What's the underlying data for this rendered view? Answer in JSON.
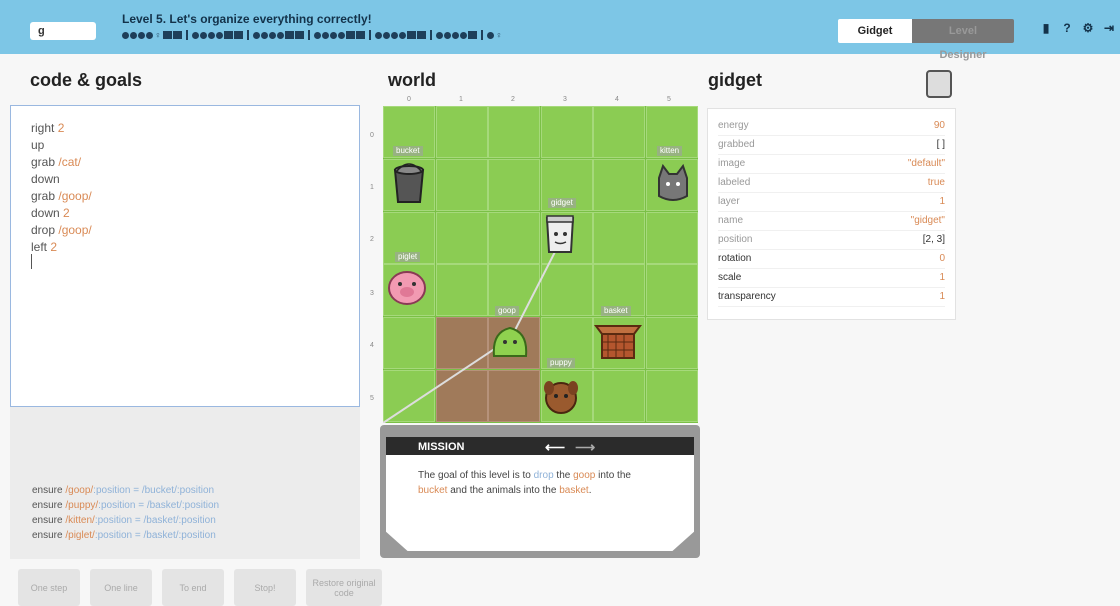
{
  "topbar": {
    "level_input": "g",
    "level_title": "Level 5. Let's organize everything correctly!",
    "tabs": [
      {
        "label": "Gidget",
        "active": true
      },
      {
        "label": "Level Designer",
        "active": false
      }
    ],
    "icons": [
      "book-icon",
      "help-icon",
      "settings-icon",
      "logout-icon"
    ],
    "accent_color": "#7dc6e6"
  },
  "code_panel": {
    "title": "code & goals",
    "code_lines": [
      {
        "cmd": "right",
        "arg": "2"
      },
      {
        "cmd": "up",
        "arg": ""
      },
      {
        "cmd": "grab",
        "arg": "/cat/"
      },
      {
        "cmd": "down",
        "arg": ""
      },
      {
        "cmd": "grab",
        "arg": "/goop/"
      },
      {
        "cmd": "down",
        "arg": "2"
      },
      {
        "cmd": "drop",
        "arg": "/goop/"
      },
      {
        "cmd": "left",
        "arg": "2"
      }
    ],
    "goals": [
      {
        "pre": "ensure ",
        "a": "/goop/",
        "mid": ":position = ",
        "b": "/bucket/",
        "post": ":position"
      },
      {
        "pre": "ensure ",
        "a": "/puppy/",
        "mid": ":position = ",
        "b": "/basket/",
        "post": ":position"
      },
      {
        "pre": "ensure ",
        "a": "/kitten/",
        "mid": ":position = ",
        "b": "/basket/",
        "post": ":position"
      },
      {
        "pre": "ensure ",
        "a": "/piglet/",
        "mid": ":position = ",
        "b": "/basket/",
        "post": ":position"
      }
    ],
    "buttons": [
      {
        "label": "One step"
      },
      {
        "label": "One line"
      },
      {
        "label": "To end"
      },
      {
        "label": "Stop!"
      },
      {
        "label": "Restore original code"
      }
    ]
  },
  "world": {
    "title": "world",
    "columns": [
      "0",
      "1",
      "2",
      "3",
      "4",
      "5"
    ],
    "rows": [
      "0",
      "1",
      "2",
      "3",
      "4",
      "5"
    ],
    "labels": [
      {
        "text": "bucket"
      },
      {
        "text": "kitten"
      },
      {
        "text": "gidget"
      },
      {
        "text": "piglet"
      },
      {
        "text": "goop"
      },
      {
        "text": "basket"
      },
      {
        "text": "puppy"
      }
    ]
  },
  "gidget_panel": {
    "title": "gidget",
    "properties": [
      {
        "key": "energy",
        "value": "90"
      },
      {
        "key": "grabbed",
        "value": "[ ]"
      },
      {
        "key": "image",
        "value": "\"default\""
      },
      {
        "key": "labeled",
        "value": "true"
      },
      {
        "key": "layer",
        "value": "1"
      },
      {
        "key": "name",
        "value": "\"gidget\""
      },
      {
        "key": "position",
        "value": "[2, 3]"
      },
      {
        "key": "rotation",
        "value": "0"
      },
      {
        "key": "scale",
        "value": "1"
      },
      {
        "key": "transparency",
        "value": "1"
      }
    ]
  },
  "mission": {
    "title": "MISSION",
    "text_parts": [
      "The goal of this level is to ",
      "drop",
      " the ",
      "goop",
      " into the ",
      "bucket",
      " and the animals into the ",
      "basket",
      "."
    ]
  }
}
